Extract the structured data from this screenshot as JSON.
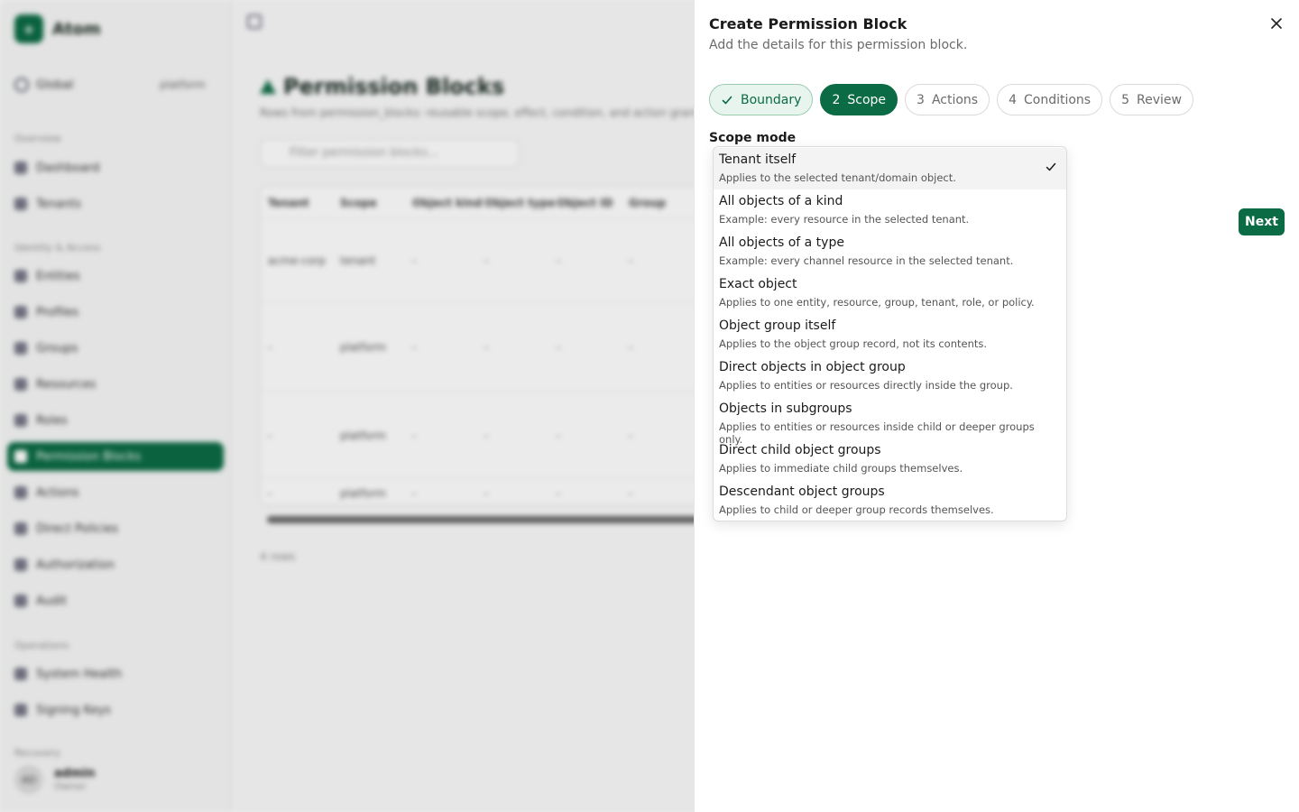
{
  "background": {
    "brand_logo": "+",
    "brand_name": "Atom",
    "context": {
      "label": "Global",
      "value": "platform",
      "icon": "globe-icon"
    },
    "sections": [
      "Overview",
      "Identity & Access",
      "Operations",
      "Recovery"
    ],
    "nav_overview": [
      "Dashboard",
      "Tenants"
    ],
    "nav_identity": [
      "Entities",
      "Profiles",
      "Groups",
      "Resources",
      "Roles",
      "Permission Blocks",
      "Actions",
      "Direct Policies",
      "Authorization",
      "Audit"
    ],
    "nav_operations": [
      "System Health",
      "Signing Keys"
    ],
    "user": {
      "initials": "AD",
      "name": "admin",
      "role": "Owner"
    },
    "page_title": "Permission Blocks",
    "page_subtitle": "Rows from permission_blocks: reusable scope, effect, condition, and action grants.",
    "filter_placeholder": "Filter permission blocks...",
    "table_headers": [
      "Tenant",
      "Scope",
      "Object kind",
      "Object type",
      "Object ID",
      "Group"
    ],
    "table_rows": [
      [
        "acme-corp",
        "tenant",
        "-",
        "-",
        "-",
        "-"
      ],
      [
        "-",
        "platform",
        "-",
        "-",
        "-",
        "-"
      ],
      [
        "-",
        "platform",
        "-",
        "-",
        "-",
        "-"
      ],
      [
        "-",
        "platform",
        "-",
        "-",
        "-",
        "-"
      ]
    ],
    "row_count": "4 rows"
  },
  "drawer": {
    "title": "Create Permission Block",
    "subtitle": "Add the details for this permission block.",
    "close_icon": "close-icon",
    "steps": [
      {
        "num": "",
        "label": "Boundary",
        "state": "done"
      },
      {
        "num": "2",
        "label": "Scope",
        "state": "active"
      },
      {
        "num": "3",
        "label": "Actions",
        "state": "pending"
      },
      {
        "num": "4",
        "label": "Conditions",
        "state": "pending"
      },
      {
        "num": "5",
        "label": "Review",
        "state": "pending"
      }
    ],
    "field_label": "Scope mode",
    "next_label": "Next",
    "accent_color": "#0b6b45",
    "options": [
      {
        "title": "Tenant itself",
        "desc": "Applies to the selected tenant/domain object.",
        "selected": true
      },
      {
        "title": "All objects of a kind",
        "desc": "Example: every resource in the selected tenant.",
        "selected": false
      },
      {
        "title": "All objects of a type",
        "desc": "Example: every channel resource in the selected tenant.",
        "selected": false
      },
      {
        "title": "Exact object",
        "desc": "Applies to one entity, resource, group, tenant, role, or policy.",
        "selected": false
      },
      {
        "title": "Object group itself",
        "desc": "Applies to the object group record, not its contents.",
        "selected": false
      },
      {
        "title": "Direct objects in object group",
        "desc": "Applies to entities or resources directly inside the group.",
        "selected": false
      },
      {
        "title": "Objects in subgroups",
        "desc": "Applies to entities or resources inside child or deeper groups only.",
        "selected": false
      },
      {
        "title": "Direct child object groups",
        "desc": "Applies to immediate child groups themselves.",
        "selected": false
      },
      {
        "title": "Descendant object groups",
        "desc": "Applies to child or deeper group records themselves.",
        "selected": false
      }
    ]
  }
}
